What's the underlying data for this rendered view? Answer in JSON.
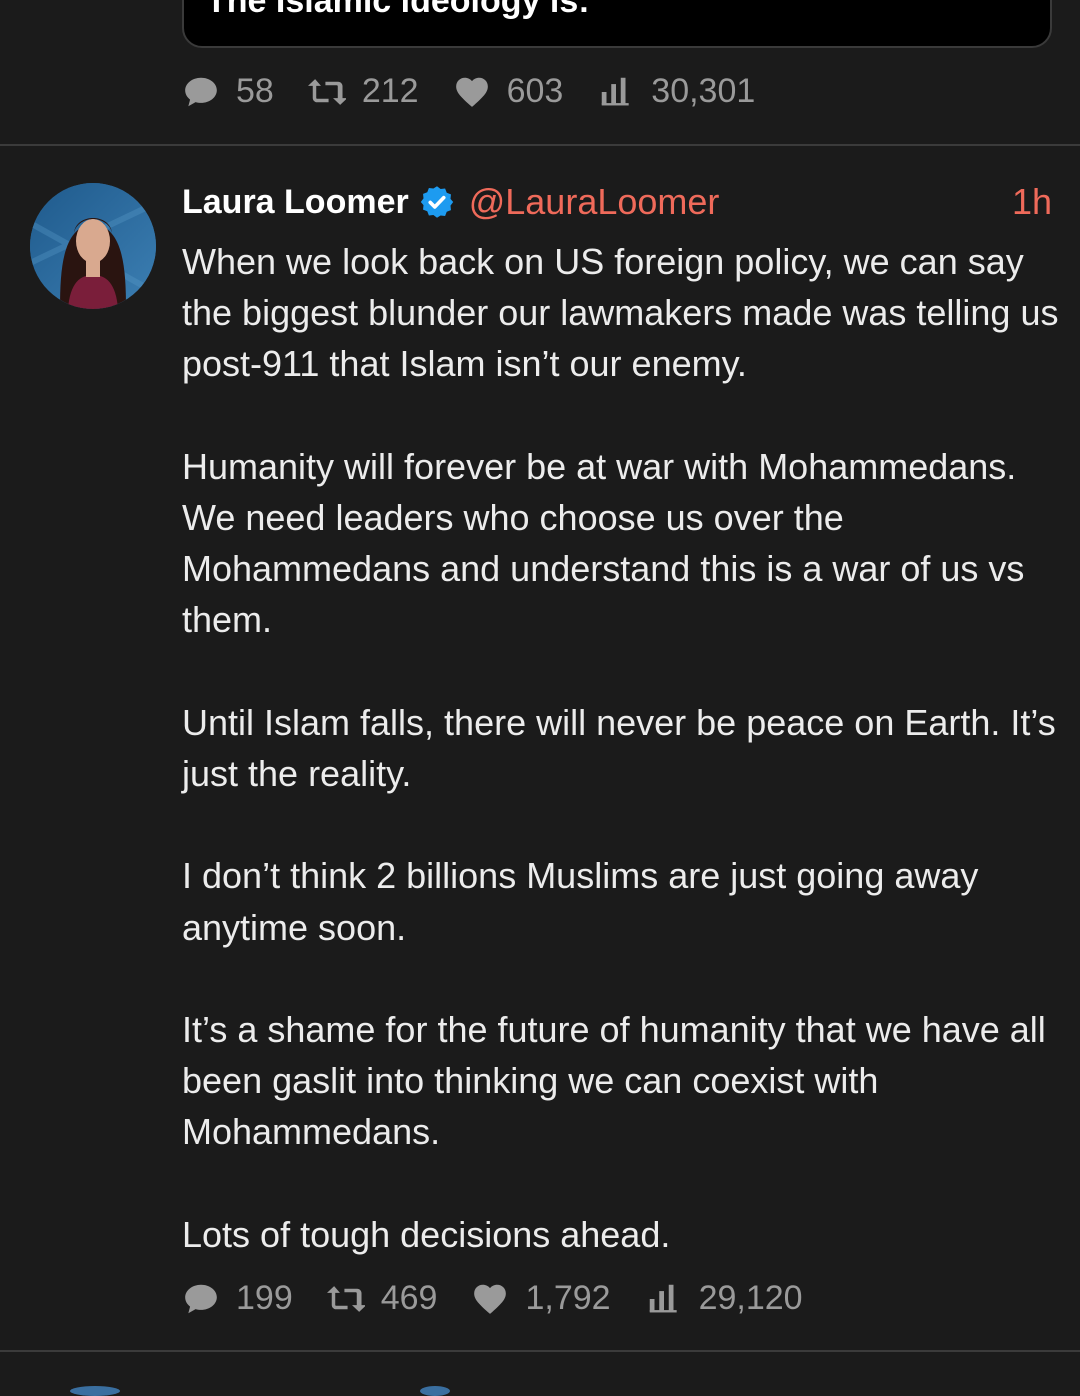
{
  "previous_tweet": {
    "quoted_text": "The Islamic ideology is:",
    "stats": {
      "replies": "58",
      "retweets": "212",
      "likes": "603",
      "views": "30,301"
    }
  },
  "tweet": {
    "author_name": "Laura Loomer",
    "handle": "@LauraLoomer",
    "time": "1h",
    "paragraphs": [
      "When we look back on US foreign policy, we can say the biggest blunder our lawmakers made was telling us post-911 that Islam isn’t our enemy.",
      "Humanity will forever be at war with Mohammedans. We need leaders who choose us over the Mohammedans and understand this is a war of us vs them.",
      "Until Islam falls, there will never be peace on Earth. It’s just the reality.",
      "I don’t think 2 billions Muslims are just going away anytime soon.",
      "It’s a shame for the future of humanity that we have all been gaslit into thinking we can coexist with Mohammedans.",
      "Lots of tough decisions ahead."
    ],
    "stats": {
      "replies": "199",
      "retweets": "469",
      "likes": "1,792",
      "views": "29,120"
    }
  },
  "colors": {
    "background": "#1b1b1b",
    "accent": "#ef6a5a",
    "verified": "#1d9bf0",
    "muted": "#9a9a9a"
  },
  "icons": [
    "reply-icon",
    "retweet-icon",
    "like-icon",
    "views-icon",
    "verified-badge-icon"
  ]
}
